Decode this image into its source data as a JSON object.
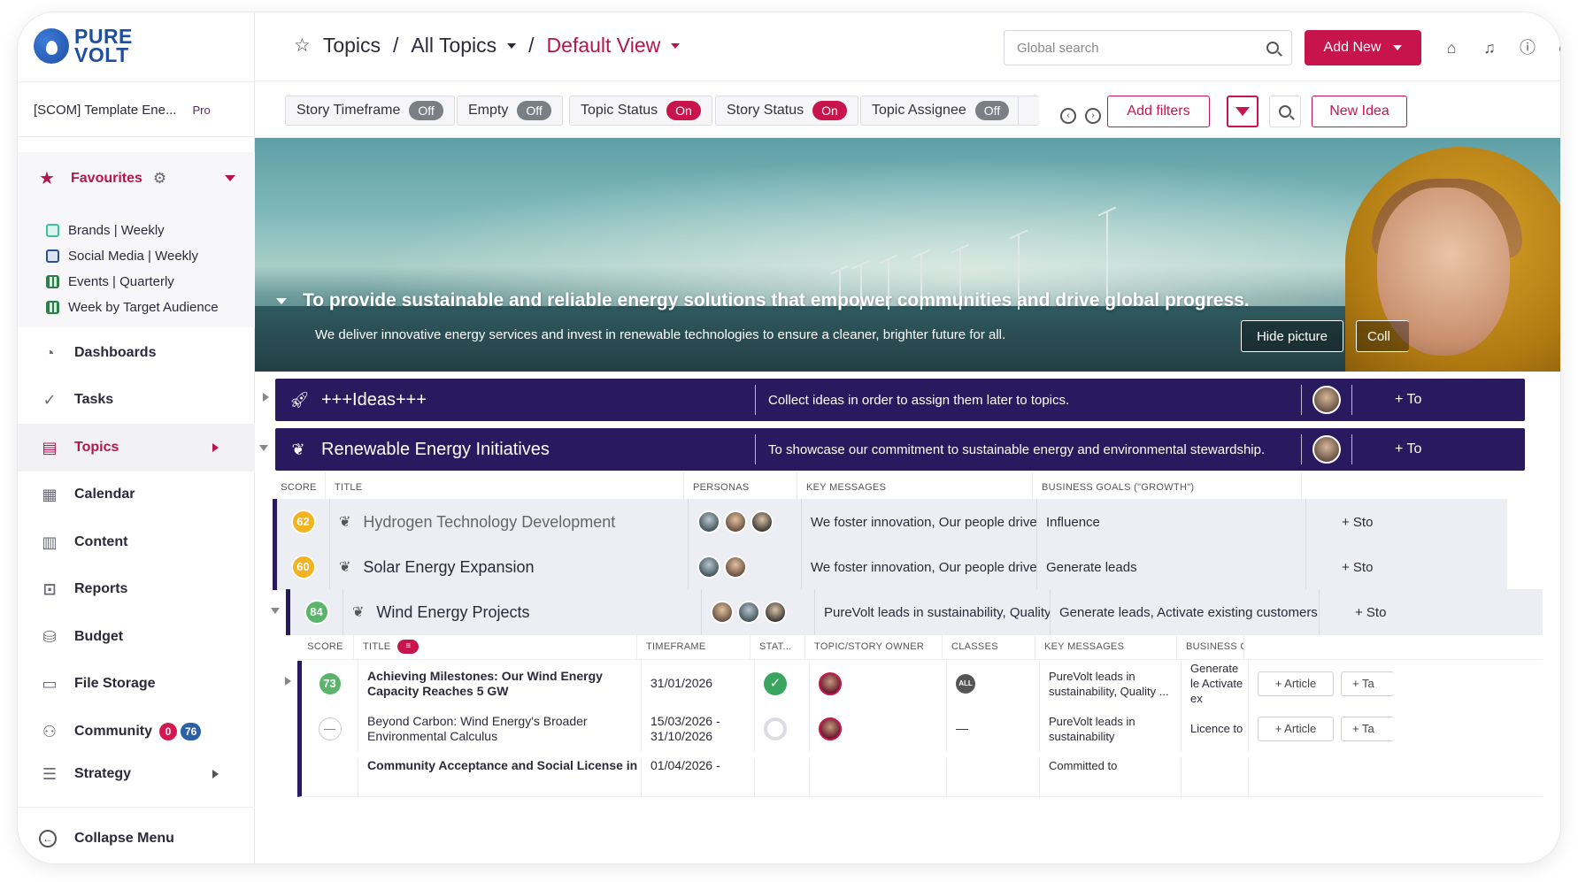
{
  "brand": {
    "line1": "PURE",
    "line2": "VOLT"
  },
  "workspace": {
    "name": "[SCOM] Template Ene...",
    "plan": "Pro"
  },
  "favourites": {
    "title": "Favourites",
    "items": [
      {
        "label": "Brands | Weekly",
        "icon": "calendar-week-icon",
        "color": "#3dbfa0"
      },
      {
        "label": "Social Media | Weekly",
        "icon": "calendar-week-icon",
        "color": "#2b4f8f"
      },
      {
        "label": "Events | Quarterly",
        "icon": "calendar-grid-icon",
        "color": "#2f7d4a"
      },
      {
        "label": "Week by Target Audience",
        "icon": "calendar-grid-icon",
        "color": "#2f7d4a"
      }
    ]
  },
  "nav": {
    "dashboards": "Dashboards",
    "tasks": "Tasks",
    "topics": "Topics",
    "calendar": "Calendar",
    "content": "Content",
    "reports": "Reports",
    "budget": "Budget",
    "file_storage": "File Storage",
    "community": "Community",
    "community_badge_red": "0",
    "community_badge_blue": "76",
    "strategy": "Strategy",
    "collapse": "Collapse Menu"
  },
  "header": {
    "crumb1": "Topics",
    "crumb2": "All Topics",
    "crumb3": "Default View",
    "search_placeholder": "Global search",
    "add_new": "Add New"
  },
  "filters": {
    "chips": [
      {
        "label": "Story Timeframe",
        "state": "Off"
      },
      {
        "label": "Empty",
        "state": "Off"
      },
      {
        "label": "Topic Status",
        "state": "On"
      },
      {
        "label": "Story Status",
        "state": "On"
      },
      {
        "label": "Topic Assignee",
        "state": "Off"
      }
    ],
    "add_filters": "Add filters",
    "new_idea": "New Idea"
  },
  "hero": {
    "title": "To provide sustainable and reliable energy solutions that empower communities and drive global progress.",
    "subtitle": "We deliver innovative energy services and invest in renewable technologies to ensure a cleaner, brighter future for all.",
    "hide_picture": "Hide picture",
    "collapse_partial": "Coll"
  },
  "categories": [
    {
      "title": "+++Ideas+++",
      "icon": "rocket-icon",
      "description": "Collect ideas in order to assign them later to topics.",
      "add": "+ To"
    },
    {
      "title": "Renewable Energy Initiatives",
      "icon": "sprout-icon",
      "description": "To showcase our commitment to sustainable energy and environmental stewardship.",
      "add": "+ To"
    }
  ],
  "topic_table": {
    "columns": [
      "SCORE",
      "TITLE",
      "PERSONAS",
      "KEY MESSAGES",
      "BUSINESS GOALS (\"GROWTH\")"
    ],
    "rows": [
      {
        "score": "62",
        "title": "Hydrogen Technology Development",
        "messages": "We foster innovation, Our people drive",
        "goals": "Influence",
        "add": "+ Sto"
      },
      {
        "score": "60",
        "title": "Solar Energy Expansion",
        "messages": "We foster innovation, Our people drive",
        "goals": "Generate leads",
        "add": "+ Sto"
      },
      {
        "score": "84",
        "title": "Wind Energy Projects",
        "messages": "PureVolt leads in sustainability, Quality",
        "goals": "Generate leads, Activate existing customers",
        "add": "+ Sto"
      }
    ]
  },
  "story_table": {
    "columns": [
      "SCORE",
      "TITLE",
      "TIMEFRAME",
      "STAT...",
      "TOPIC/STORY OWNER",
      "CLASSES",
      "KEY MESSAGES",
      "BUSINESS G"
    ],
    "rows": [
      {
        "score": "73",
        "title": "Achieving Milestones: Our Wind Energy Capacity Reaches 5 GW",
        "timeframe": "31/01/2026",
        "class": "ALL",
        "messages": "PureVolt leads in sustainability, Quality ...",
        "goals": "Generate le Activate ex",
        "article": "+ Article",
        "task": "+ Ta"
      },
      {
        "score": "—",
        "title": "Beyond Carbon: Wind Energy's Broader Environmental Calculus",
        "timeframe": "15/03/2026 - 31/10/2026",
        "class": "—",
        "messages": "PureVolt leads in sustainability",
        "goals": "Licence to",
        "article": "+ Article",
        "task": "+ Ta"
      },
      {
        "score": "",
        "title": "Community Acceptance and Social License in",
        "timeframe": "01/04/2026 -",
        "class": "",
        "messages": "Committed to",
        "goals": "",
        "article": "",
        "task": ""
      }
    ]
  }
}
